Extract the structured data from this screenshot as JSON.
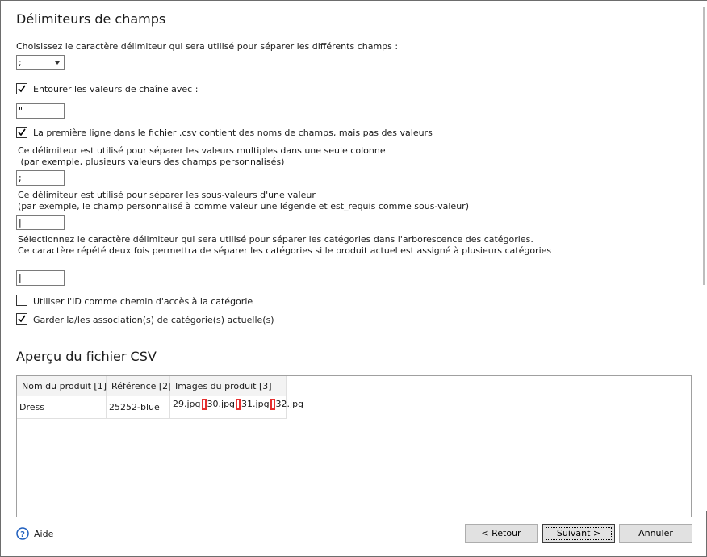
{
  "section_delimiters": {
    "title": "Délimiteurs de champs",
    "field_delim_label": "Choisissez le caractère délimiteur qui sera utilisé pour séparer les différents champs :",
    "field_delim_value": ";",
    "enclose_checked": true,
    "enclose_label": "Entourer les valeurs de chaîne avec :",
    "enclose_value": "\"",
    "header_row_checked": true,
    "header_row_label": "La première ligne dans le fichier .csv contient des noms de champs, mais pas des valeurs",
    "multi_value_label_1": "Ce délimiteur est utilisé pour séparer les valeurs multiples dans une seule colonne",
    "multi_value_label_2": " (par exemple, plusieurs valeurs des champs personnalisés)",
    "multi_value_value": ";",
    "sub_value_label_1": "Ce délimiteur est utilisé pour séparer les sous-valeurs d'une valeur",
    "sub_value_label_2": "(par exemple, le champ personnalisé à comme valeur une légende et est_requis comme sous-valeur)",
    "sub_value_value": "|",
    "category_label_1": "Sélectionnez le caractère délimiteur qui sera utilisé pour séparer les catégories dans l'arborescence des catégories.",
    "category_label_2": "Ce caractère répété deux fois permettra de séparer les catégories si le produit actuel est assigné à plusieurs catégories",
    "category_value": "|",
    "use_id_checked": false,
    "use_id_label": "Utiliser l'ID comme chemin d'accès à la catégorie",
    "keep_assoc_checked": true,
    "keep_assoc_label": "Garder la/les association(s) de catégorie(s) actuelle(s)"
  },
  "preview": {
    "title": "Aperçu du fichier CSV",
    "columns": [
      "Nom du produit [1]",
      "Référence [2]",
      "Images du produit [3]"
    ],
    "row": {
      "name": "Dress",
      "reference": "25252-blue",
      "images": [
        "29.jpg",
        "30.jpg",
        "31.jpg",
        "32.jpg"
      ]
    },
    "separator_color": "#e53030"
  },
  "footer": {
    "help_label": "Aide",
    "back_label": "< Retour",
    "next_label": "Suivant >",
    "cancel_label": "Annuler"
  }
}
